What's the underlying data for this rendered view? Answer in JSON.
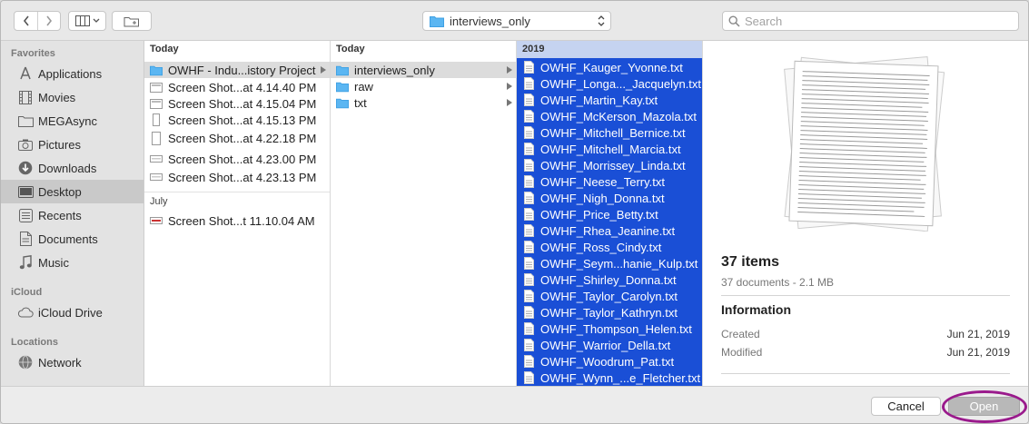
{
  "toolbar": {
    "location": "interviews_only",
    "search_placeholder": "Search"
  },
  "sidebar": {
    "favorites_label": "Favorites",
    "favorites": [
      {
        "label": "Applications",
        "icon": "applications-icon"
      },
      {
        "label": "Movies",
        "icon": "movies-icon"
      },
      {
        "label": "MEGAsync",
        "icon": "folder-icon"
      },
      {
        "label": "Pictures",
        "icon": "camera-icon"
      },
      {
        "label": "Downloads",
        "icon": "download-icon"
      },
      {
        "label": "Desktop",
        "icon": "desktop-icon",
        "selected": true
      },
      {
        "label": "Recents",
        "icon": "recents-icon"
      },
      {
        "label": "Documents",
        "icon": "document-icon"
      },
      {
        "label": "Music",
        "icon": "music-icon"
      }
    ],
    "icloud_label": "iCloud",
    "icloud": [
      {
        "label": "iCloud Drive",
        "icon": "cloud-icon"
      }
    ],
    "locations_label": "Locations",
    "locations": [
      {
        "label": "Network",
        "icon": "network-icon"
      }
    ]
  },
  "column1": {
    "header": "Today",
    "items": [
      {
        "label": "OWHF - Indu...istory Project",
        "type": "folder",
        "selected": true
      },
      {
        "label": "Screen Shot...at 4.14.40 PM",
        "type": "image"
      },
      {
        "label": "Screen Shot...at 4.15.04 PM",
        "type": "image"
      },
      {
        "label": "Screen Shot...at 4.15.13 PM",
        "type": "image"
      },
      {
        "label": "Screen Shot...at 4.22.18 PM",
        "type": "image"
      },
      {
        "label": "Screen Shot...at 4.23.00 PM",
        "type": "image"
      },
      {
        "label": "Screen Shot...at 4.23.13 PM",
        "type": "image"
      }
    ],
    "header2": "July",
    "items2": [
      {
        "label": "Screen Shot...t 11.10.04 AM",
        "type": "image"
      }
    ]
  },
  "column2": {
    "header": "Today",
    "items": [
      {
        "label": "interviews_only",
        "type": "folder",
        "selected": true
      },
      {
        "label": "raw",
        "type": "folder"
      },
      {
        "label": "txt",
        "type": "folder"
      }
    ]
  },
  "column3": {
    "header": "2019",
    "items": [
      "OWHF_Kauger_Yvonne.txt",
      "OWHF_Longa..._Jacquelyn.txt",
      "OWHF_Martin_Kay.txt",
      "OWHF_McKerson_Mazola.txt",
      "OWHF_Mitchell_Bernice.txt",
      "OWHF_Mitchell_Marcia.txt",
      "OWHF_Morrissey_Linda.txt",
      "OWHF_Neese_Terry.txt",
      "OWHF_Nigh_Donna.txt",
      "OWHF_Price_Betty.txt",
      "OWHF_Rhea_Jeanine.txt",
      "OWHF_Ross_Cindy.txt",
      "OWHF_Seym...hanie_Kulp.txt",
      "OWHF_Shirley_Donna.txt",
      "OWHF_Taylor_Carolyn.txt",
      "OWHF_Taylor_Kathryn.txt",
      "OWHF_Thompson_Helen.txt",
      "OWHF_Warrior_Della.txt",
      "OWHF_Woodrum_Pat.txt",
      "OWHF_Wynn_...e_Fletcher.txt"
    ]
  },
  "preview": {
    "count": "37 items",
    "subtitle": "37 documents - 2.1 MB",
    "info_heading": "Information",
    "created_label": "Created",
    "created_value": "Jun 21, 2019",
    "modified_label": "Modified",
    "modified_value": "Jun 21, 2019"
  },
  "buttons": {
    "cancel": "Cancel",
    "open": "Open"
  },
  "colors": {
    "selection_blue": "#1a4fd6",
    "highlight_ring": "#9a1a8c"
  }
}
